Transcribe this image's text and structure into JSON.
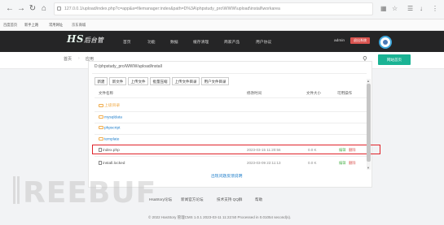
{
  "browser": {
    "url": "127.0.0.1/upload/index.php?c=app&a=filemanager:index&path=D%3A\\phpstudy_pro\\WWW\\upload\\install\\workarea",
    "back_icon": "back-arrow-icon",
    "forward_icon": "forward-arrow-icon",
    "reload_icon": "reload-icon",
    "home_icon": "home-icon"
  },
  "bookmarks": [
    "百度首页",
    "新手上路",
    "常用网址",
    "京东商城"
  ],
  "header": {
    "logo": "HS",
    "logo_sub": "后台管",
    "menu": [
      "首页",
      "功能",
      "数据",
      "缓存清理",
      "商家产品",
      "用户协议"
    ],
    "user": "admin",
    "logout": "退出系统"
  },
  "subnav": {
    "crumbs": [
      "首页",
      "应用"
    ],
    "home_button": "网站首页"
  },
  "filemanager": {
    "path": "D:/phpstudy_pro/WWW/upload/install",
    "toolbar": [
      "新建",
      "新文件",
      "上传文件",
      "批量压缩",
      "上传文件目录",
      "用户文件目录"
    ],
    "columns": [
      "文件名称",
      "修改时间",
      "文件大小",
      "可用操作"
    ],
    "rows": [
      {
        "name": "上级目录",
        "type": "up",
        "time": "",
        "size": "",
        "edit": "",
        "del": ""
      },
      {
        "name": "mysqldata",
        "type": "folder",
        "time": "",
        "size": "",
        "edit": "",
        "del": ""
      },
      {
        "name": "phpscript",
        "type": "folder",
        "time": "",
        "size": "",
        "edit": "",
        "del": ""
      },
      {
        "name": "template",
        "type": "folder",
        "time": "",
        "size": "",
        "edit": "",
        "del": ""
      },
      {
        "name": "index.php",
        "type": "file",
        "time": "2023-03-15 11:20:56",
        "size": "0.0 K",
        "edit": "编辑",
        "del": "删除"
      },
      {
        "name": "install.locked",
        "type": "file",
        "time": "2023-03-09 22:11:13",
        "size": "0.0 K",
        "edit": "编辑",
        "del": "删除"
      }
    ],
    "save_link": "出现问题反馈说明"
  },
  "footer": {
    "links": [
      "HsaStory论坛",
      "新闻官方论坛",
      "技术支持 QQ群",
      "帮助"
    ],
    "copyright": "© 2022 HasStory 管理CMS 1.0.1 2023-03-11 11:22:50 Processed in 0.01054 second(s)."
  },
  "watermark": "REEBUF"
}
